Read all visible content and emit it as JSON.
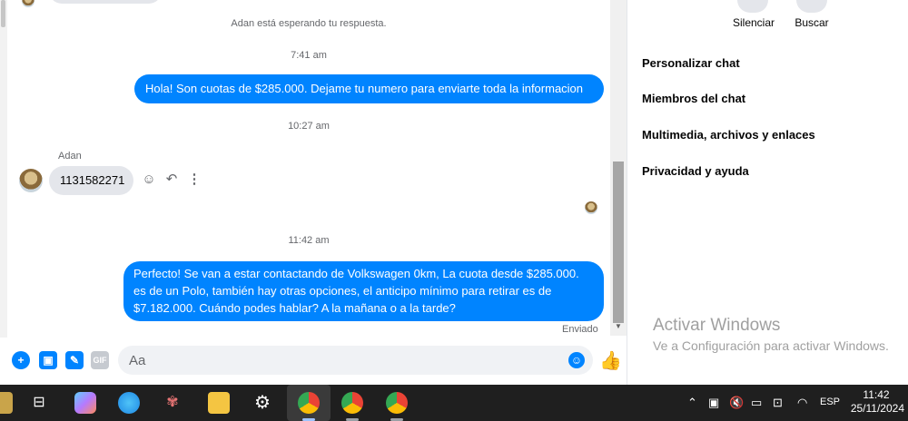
{
  "chat": {
    "waiting_text": "Adan está esperando tu respuesta.",
    "messages": [
      {
        "time": "7:41 am",
        "text": "Hola! Son cuotas de $285.000. Dejame tu numero para enviarte toda la informacion"
      },
      {
        "time": "10:27 am",
        "sender": "Adan",
        "text": "1131582271"
      },
      {
        "time": "11:42 am",
        "text_lines": [
          "Perfecto!  Se van a estar contactando de Volkswagen 0km, La cuota desde $285.000.",
          "es de un Polo, también hay otras opciones, el anticipo mínimo para retirar es de",
          "$7.182.000. Cuándo podes hablar? A la mañana o a la tarde?"
        ]
      }
    ],
    "status": "Enviado",
    "composer_placeholder": "Aa",
    "gif_label": "GIF"
  },
  "side": {
    "mute_label": "Silenciar",
    "search_label": "Buscar",
    "items": [
      "Personalizar chat",
      "Miembros del chat",
      "Multimedia, archivos y enlaces",
      "Privacidad y ayuda"
    ]
  },
  "watermark": {
    "title": "Activar Windows",
    "subtitle": "Ve a Configuración para activar Windows."
  },
  "taskbar": {
    "lang": "ESP",
    "time": "11:42",
    "date": "25/11/2024"
  },
  "colors": {
    "accent": "#0084ff",
    "bubble_in": "#e4e6eb",
    "taskbar": "#1f1f1f"
  }
}
